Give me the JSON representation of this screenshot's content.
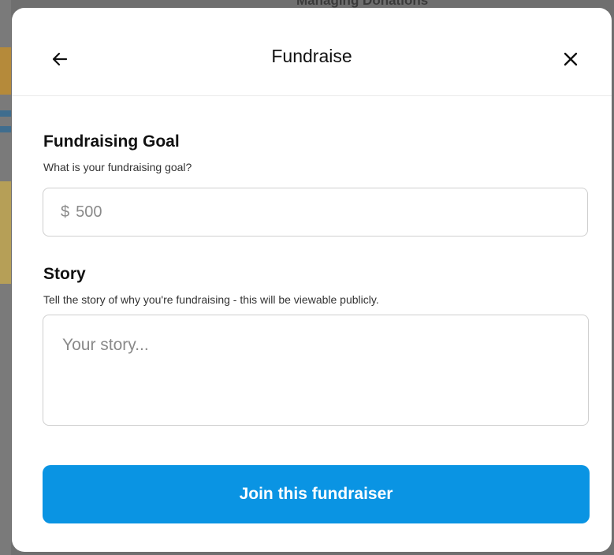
{
  "background": {
    "partial_heading": "Managing Donations"
  },
  "modal": {
    "title": "Fundraise",
    "back_icon": "arrow-left-icon",
    "close_icon": "close-icon"
  },
  "goal": {
    "label": "Fundraising Goal",
    "help": "What is your fundraising goal?",
    "currency": "$",
    "placeholder": "500"
  },
  "story": {
    "label": "Story",
    "help": "Tell the story of why you're fundraising - this will be viewable publicly.",
    "placeholder": "Your story..."
  },
  "actions": {
    "join_label": "Join this fundraiser"
  },
  "colors": {
    "primary_button": "#0a94e3",
    "text": "#111111",
    "placeholder": "#8a8a8a",
    "border": "#cfcfcf"
  }
}
